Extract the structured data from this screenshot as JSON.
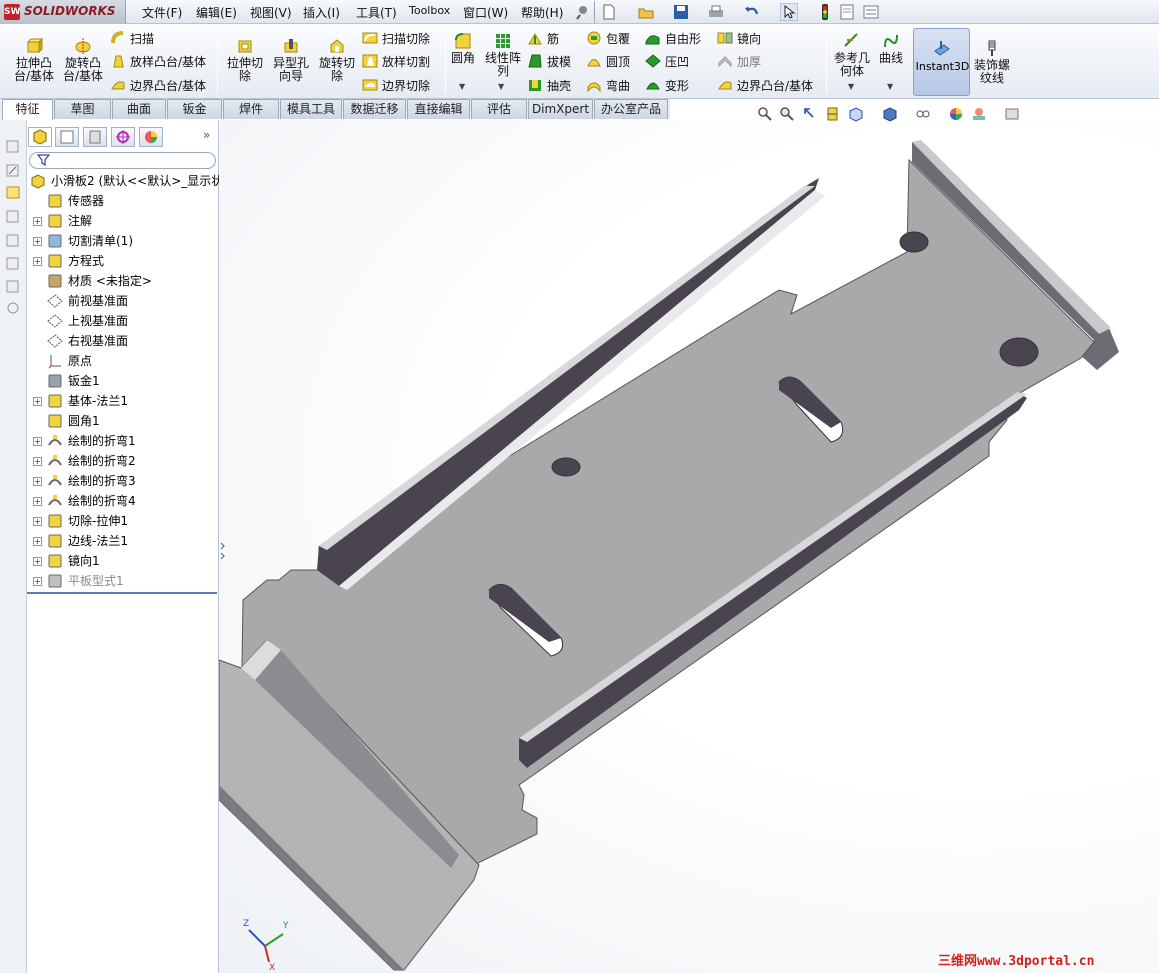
{
  "app": {
    "logo_text": "SOLIDWORKS",
    "logo_mark": "SW"
  },
  "menu": {
    "items": [
      "文件(F)",
      "编辑(E)",
      "视图(V)",
      "插入(I)",
      "工具(T)",
      "Toolbox",
      "窗口(W)",
      "帮助(H)"
    ]
  },
  "ribbon": {
    "extrude_boss": "拉伸凸\n台/基体",
    "revolve_boss": "旋转凸\n台/基体",
    "sweep": "扫描",
    "loft_boss": "放样凸台/基体",
    "boundary_boss": "边界凸台/基体",
    "extrude_cut": "拉伸切\n除",
    "hole_wizard": "异型孔\n向导",
    "revolve_cut": "旋转切\n除",
    "sweep_cut": "扫描切除",
    "loft_cut": "放样切割",
    "boundary_cut": "边界切除",
    "fillet": "圆角",
    "linear_pattern": "线性阵\n列",
    "rib": "筋",
    "draft": "拔模",
    "shell": "抽壳",
    "wrap": "包覆",
    "dome": "圆顶",
    "flex": "弯曲",
    "freeform": "自由形",
    "indent": "压凹",
    "deform": "变形",
    "mirror": "镜向",
    "thicken": "加厚",
    "boundary_boss2": "边界凸台/基体",
    "ref_geometry": "参考几\n何体",
    "curves": "曲线",
    "instant3d": "Instant3D",
    "cosmetic_thread": "装饰螺\n纹线"
  },
  "tabs": [
    "特征",
    "草图",
    "曲面",
    "钣金",
    "焊件",
    "模具工具",
    "数据迁移",
    "直接编辑",
    "评估",
    "DimXpert",
    "办公室产品"
  ],
  "active_tab": "特征",
  "tree": {
    "root": "小滑板2  (默认<<默认>_显示状",
    "nodes": [
      {
        "label": "传感器",
        "icon": "sensor-icon",
        "expandable": false
      },
      {
        "label": "注解",
        "icon": "annotation-icon",
        "expandable": true
      },
      {
        "label": "切割清单(1)",
        "icon": "cut-list-icon",
        "expandable": true
      },
      {
        "label": "方程式",
        "icon": "equation-icon",
        "expandable": true
      },
      {
        "label": "材质 <未指定>",
        "icon": "material-icon",
        "expandable": false
      },
      {
        "label": "前视基准面",
        "icon": "plane-icon",
        "expandable": false
      },
      {
        "label": "上视基准面",
        "icon": "plane-icon",
        "expandable": false
      },
      {
        "label": "右视基准面",
        "icon": "plane-icon",
        "expandable": false
      },
      {
        "label": "原点",
        "icon": "origin-icon",
        "expandable": false
      },
      {
        "label": "钣金1",
        "icon": "sheet-metal-icon",
        "expandable": false
      },
      {
        "label": "基体-法兰1",
        "icon": "base-flange-icon",
        "expandable": true
      },
      {
        "label": "圆角1",
        "icon": "fillet-icon",
        "expandable": false
      },
      {
        "label": "绘制的折弯1",
        "icon": "sketched-bend-icon",
        "expandable": true
      },
      {
        "label": "绘制的折弯2",
        "icon": "sketched-bend-icon",
        "expandable": true
      },
      {
        "label": "绘制的折弯3",
        "icon": "sketched-bend-icon",
        "expandable": true
      },
      {
        "label": "绘制的折弯4",
        "icon": "sketched-bend-icon",
        "expandable": true
      },
      {
        "label": "切除-拉伸1",
        "icon": "cut-extrude-icon",
        "expandable": true
      },
      {
        "label": "边线-法兰1",
        "icon": "edge-flange-icon",
        "expandable": true
      },
      {
        "label": "镜向1",
        "icon": "mirror-icon",
        "expandable": true
      },
      {
        "label": "平板型式1",
        "icon": "flat-pattern-icon",
        "expandable": true,
        "suppressed": true
      }
    ]
  },
  "watermark": "三维网www.3dportal.cn",
  "triad": {
    "x": "X",
    "y": "Y",
    "z": "Z"
  },
  "colors": {
    "part_face": "#a9a9a9",
    "part_shadow": "#4a4350",
    "logo": "#c0232c",
    "watermark": "#d0221c"
  }
}
